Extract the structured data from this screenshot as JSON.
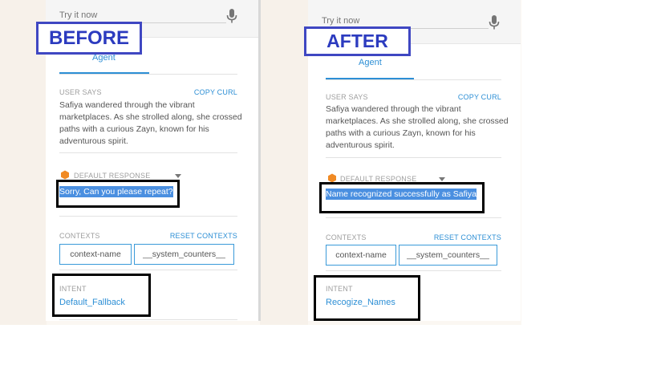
{
  "labels": {
    "before": "BEFORE",
    "after": "AFTER"
  },
  "before": {
    "try_it_now": "Try it now",
    "agent_tab": "Agent",
    "user_says_label": "USER SAYS",
    "copy_curl": "COPY CURL",
    "user_says_text": "Safiya wandered through the vibrant marketplaces. As she strolled along, she crossed paths with a curious Zayn, known for his adventurous spirit.",
    "default_response_label": "DEFAULT RESPONSE",
    "response_text": "Sorry, Can you please repeat?",
    "contexts_label": "CONTEXTS",
    "reset_contexts": "RESET CONTEXTS",
    "contexts": [
      "context-name",
      "__system_counters__"
    ],
    "intent_label": "INTENT",
    "intent_value": "Default_Fallback"
  },
  "after": {
    "try_it_now": "Try it now",
    "agent_tab": "Agent",
    "user_says_label": "USER SAYS",
    "copy_curl": "COPY CURL",
    "user_says_text": "Safiya wandered through the vibrant marketplaces. As she strolled along, she crossed paths with a curious Zayn, known for his adventurous spirit.",
    "default_response_label": "DEFAULT RESPONSE",
    "response_text": "Name recognized successfully as Safiya",
    "contexts_label": "CONTEXTS",
    "reset_contexts": "RESET CONTEXTS",
    "contexts": [
      "context-name",
      "__system_counters__"
    ],
    "intent_label": "INTENT",
    "intent_value": "Recogize_Names"
  },
  "colors": {
    "accent_blue": "#2d8fd5",
    "highlight": "#4a8fe0",
    "label_box_blue": "#3f47c2",
    "default_response_icon": "#f08a24"
  },
  "icons": {
    "mic": "microphone-icon",
    "response": "hexagon-icon",
    "dropdown": "dropdown-arrow-icon"
  }
}
